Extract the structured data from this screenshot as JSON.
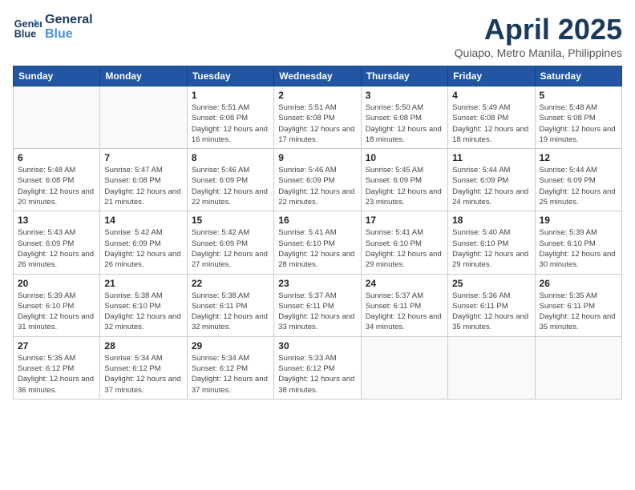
{
  "header": {
    "logo_line1": "General",
    "logo_line2": "Blue",
    "month_title": "April 2025",
    "location": "Quiapo, Metro Manila, Philippines"
  },
  "weekdays": [
    "Sunday",
    "Monday",
    "Tuesday",
    "Wednesday",
    "Thursday",
    "Friday",
    "Saturday"
  ],
  "weeks": [
    [
      {
        "day": "",
        "info": ""
      },
      {
        "day": "",
        "info": ""
      },
      {
        "day": "1",
        "info": "Sunrise: 5:51 AM\nSunset: 6:08 PM\nDaylight: 12 hours and 16 minutes."
      },
      {
        "day": "2",
        "info": "Sunrise: 5:51 AM\nSunset: 6:08 PM\nDaylight: 12 hours and 17 minutes."
      },
      {
        "day": "3",
        "info": "Sunrise: 5:50 AM\nSunset: 6:08 PM\nDaylight: 12 hours and 18 minutes."
      },
      {
        "day": "4",
        "info": "Sunrise: 5:49 AM\nSunset: 6:08 PM\nDaylight: 12 hours and 18 minutes."
      },
      {
        "day": "5",
        "info": "Sunrise: 5:48 AM\nSunset: 6:08 PM\nDaylight: 12 hours and 19 minutes."
      }
    ],
    [
      {
        "day": "6",
        "info": "Sunrise: 5:48 AM\nSunset: 6:08 PM\nDaylight: 12 hours and 20 minutes."
      },
      {
        "day": "7",
        "info": "Sunrise: 5:47 AM\nSunset: 6:08 PM\nDaylight: 12 hours and 21 minutes."
      },
      {
        "day": "8",
        "info": "Sunrise: 5:46 AM\nSunset: 6:09 PM\nDaylight: 12 hours and 22 minutes."
      },
      {
        "day": "9",
        "info": "Sunrise: 5:46 AM\nSunset: 6:09 PM\nDaylight: 12 hours and 22 minutes."
      },
      {
        "day": "10",
        "info": "Sunrise: 5:45 AM\nSunset: 6:09 PM\nDaylight: 12 hours and 23 minutes."
      },
      {
        "day": "11",
        "info": "Sunrise: 5:44 AM\nSunset: 6:09 PM\nDaylight: 12 hours and 24 minutes."
      },
      {
        "day": "12",
        "info": "Sunrise: 5:44 AM\nSunset: 6:09 PM\nDaylight: 12 hours and 25 minutes."
      }
    ],
    [
      {
        "day": "13",
        "info": "Sunrise: 5:43 AM\nSunset: 6:09 PM\nDaylight: 12 hours and 26 minutes."
      },
      {
        "day": "14",
        "info": "Sunrise: 5:42 AM\nSunset: 6:09 PM\nDaylight: 12 hours and 26 minutes."
      },
      {
        "day": "15",
        "info": "Sunrise: 5:42 AM\nSunset: 6:09 PM\nDaylight: 12 hours and 27 minutes."
      },
      {
        "day": "16",
        "info": "Sunrise: 5:41 AM\nSunset: 6:10 PM\nDaylight: 12 hours and 28 minutes."
      },
      {
        "day": "17",
        "info": "Sunrise: 5:41 AM\nSunset: 6:10 PM\nDaylight: 12 hours and 29 minutes."
      },
      {
        "day": "18",
        "info": "Sunrise: 5:40 AM\nSunset: 6:10 PM\nDaylight: 12 hours and 29 minutes."
      },
      {
        "day": "19",
        "info": "Sunrise: 5:39 AM\nSunset: 6:10 PM\nDaylight: 12 hours and 30 minutes."
      }
    ],
    [
      {
        "day": "20",
        "info": "Sunrise: 5:39 AM\nSunset: 6:10 PM\nDaylight: 12 hours and 31 minutes."
      },
      {
        "day": "21",
        "info": "Sunrise: 5:38 AM\nSunset: 6:10 PM\nDaylight: 12 hours and 32 minutes."
      },
      {
        "day": "22",
        "info": "Sunrise: 5:38 AM\nSunset: 6:11 PM\nDaylight: 12 hours and 32 minutes."
      },
      {
        "day": "23",
        "info": "Sunrise: 5:37 AM\nSunset: 6:11 PM\nDaylight: 12 hours and 33 minutes."
      },
      {
        "day": "24",
        "info": "Sunrise: 5:37 AM\nSunset: 6:11 PM\nDaylight: 12 hours and 34 minutes."
      },
      {
        "day": "25",
        "info": "Sunrise: 5:36 AM\nSunset: 6:11 PM\nDaylight: 12 hours and 35 minutes."
      },
      {
        "day": "26",
        "info": "Sunrise: 5:35 AM\nSunset: 6:11 PM\nDaylight: 12 hours and 35 minutes."
      }
    ],
    [
      {
        "day": "27",
        "info": "Sunrise: 5:35 AM\nSunset: 6:12 PM\nDaylight: 12 hours and 36 minutes."
      },
      {
        "day": "28",
        "info": "Sunrise: 5:34 AM\nSunset: 6:12 PM\nDaylight: 12 hours and 37 minutes."
      },
      {
        "day": "29",
        "info": "Sunrise: 5:34 AM\nSunset: 6:12 PM\nDaylight: 12 hours and 37 minutes."
      },
      {
        "day": "30",
        "info": "Sunrise: 5:33 AM\nSunset: 6:12 PM\nDaylight: 12 hours and 38 minutes."
      },
      {
        "day": "",
        "info": ""
      },
      {
        "day": "",
        "info": ""
      },
      {
        "day": "",
        "info": ""
      }
    ]
  ]
}
